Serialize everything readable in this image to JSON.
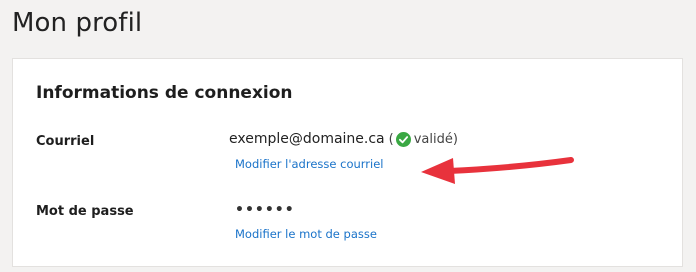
{
  "page": {
    "title": "Mon profil"
  },
  "login_section": {
    "title": "Informations de connexion",
    "email": {
      "label": "Courriel",
      "value": "exemple@domaine.ca",
      "status_open": "(",
      "status_text": "validé)",
      "status_icon": "check-circle-icon",
      "status_color": "#3aa843",
      "edit_link": "Modifier l'adresse courriel"
    },
    "password": {
      "label": "Mot de passe",
      "masked_value": "••••••",
      "edit_link": "Modifier le mot de passe"
    }
  },
  "annotation": {
    "icon": "red-arrow-icon",
    "color": "#e8323c"
  },
  "colors": {
    "link": "#1a73c9",
    "background": "#f3f2f1",
    "card": "#ffffff"
  }
}
